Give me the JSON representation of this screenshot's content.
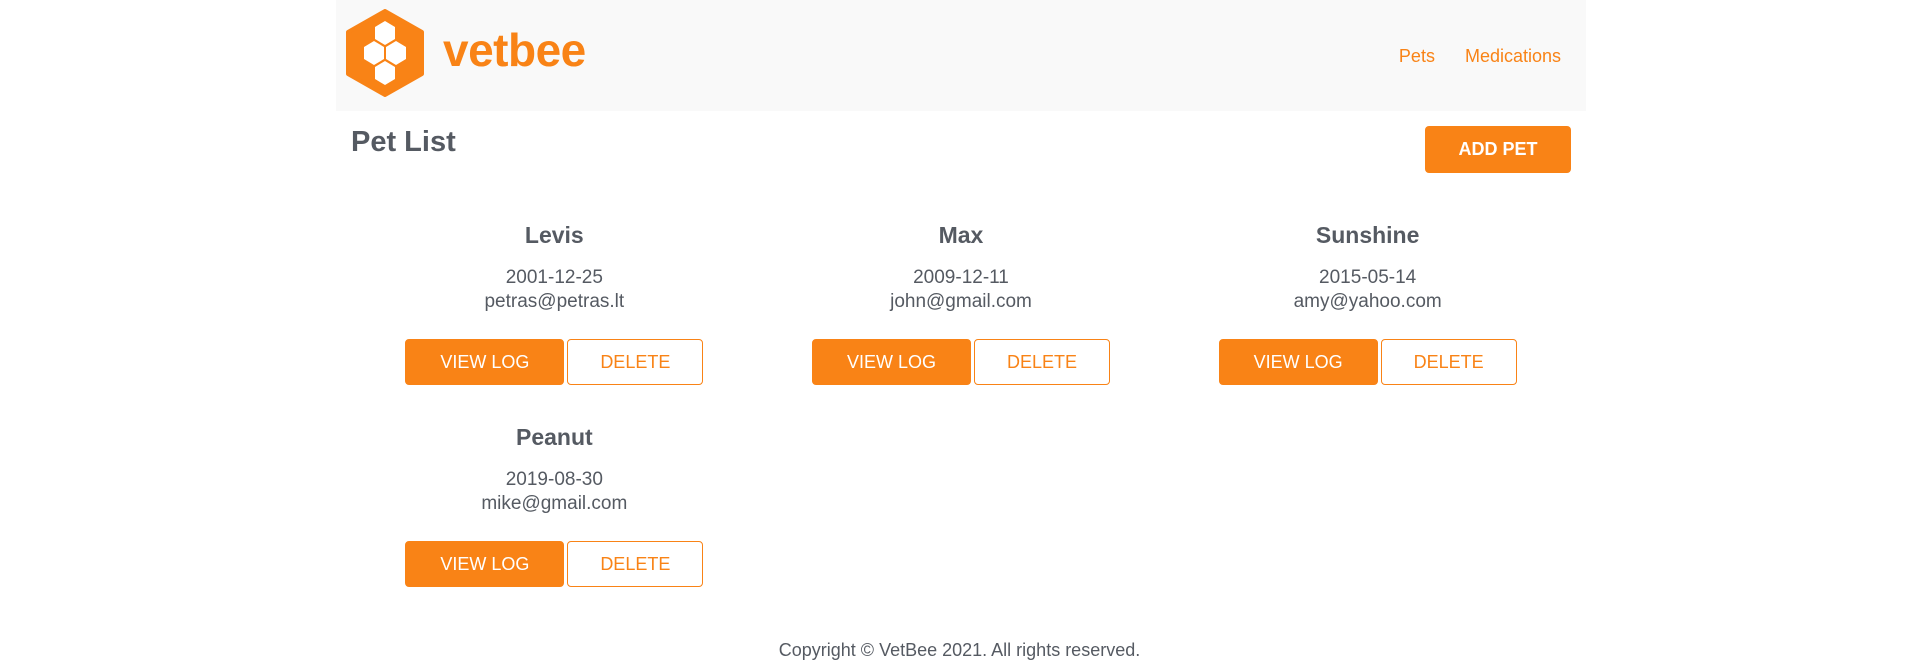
{
  "brand": {
    "name": "vetbee",
    "accent_color": "#f98316"
  },
  "nav": {
    "items": [
      {
        "label": "Pets"
      },
      {
        "label": "Medications"
      }
    ]
  },
  "main": {
    "title": "Pet List",
    "add_label": "ADD PET",
    "view_label": "VIEW LOG",
    "delete_label": "DELETE",
    "pets": [
      {
        "name": "Levis",
        "dob": "2001-12-25",
        "email": "petras@petras.lt"
      },
      {
        "name": "Max",
        "dob": "2009-12-11",
        "email": "john@gmail.com"
      },
      {
        "name": "Sunshine",
        "dob": "2015-05-14",
        "email": "amy@yahoo.com"
      },
      {
        "name": "Peanut",
        "dob": "2019-08-30",
        "email": "mike@gmail.com"
      }
    ]
  },
  "footer": {
    "text": "Copyright © VetBee 2021. All rights reserved."
  }
}
